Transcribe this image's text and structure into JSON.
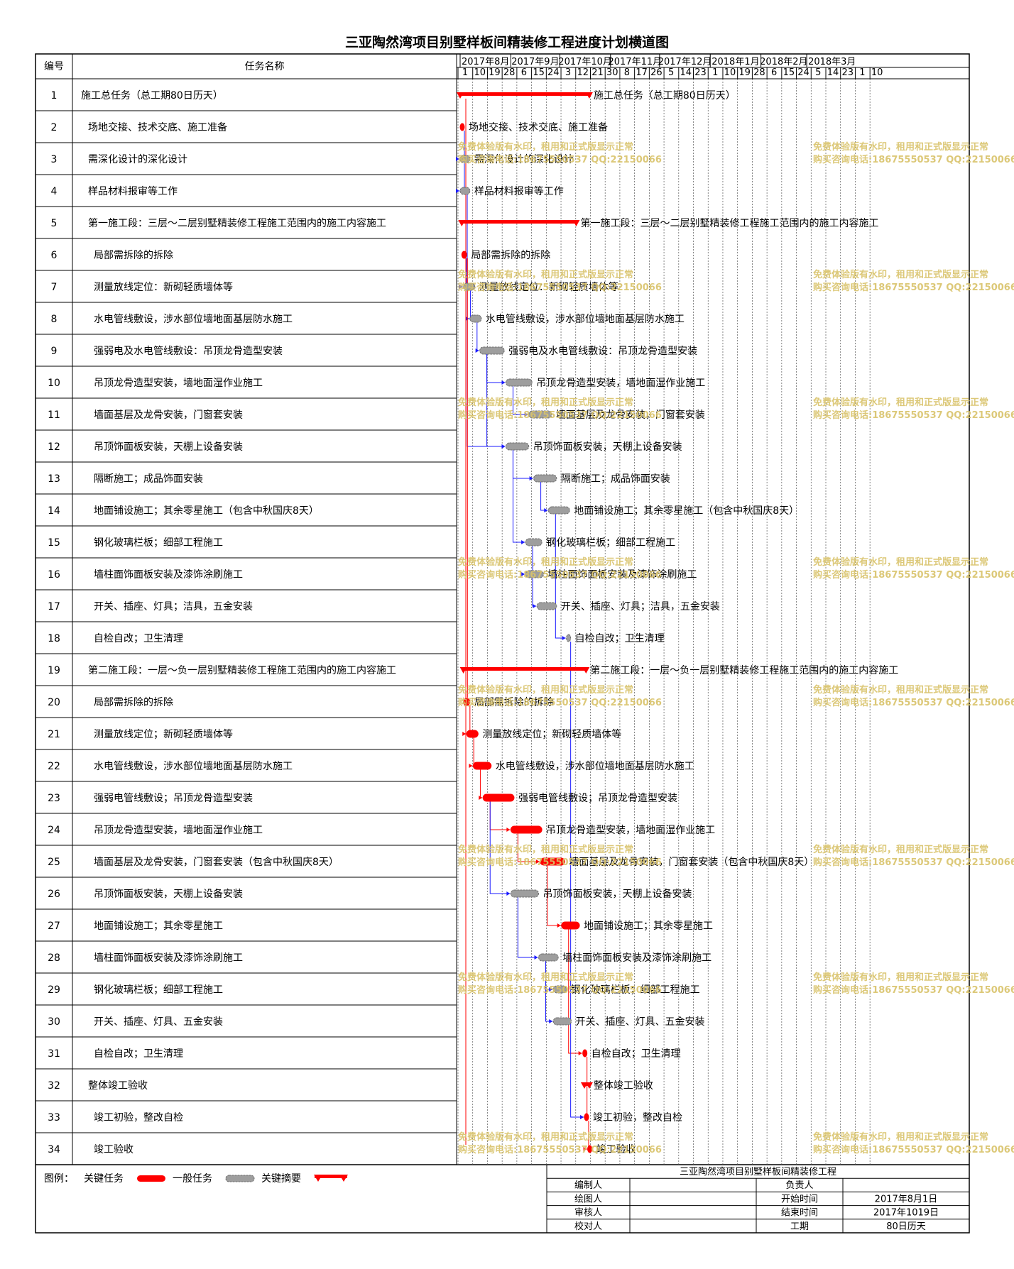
{
  "title": "三亚陶然湾项目别墅样板间精装修工程进度计划横道图",
  "columns": {
    "id": "编号",
    "name": "任务名称"
  },
  "timeline": {
    "months": [
      "2017年8月",
      "2017年9月",
      "2017年10月",
      "2017年11月",
      "2017年12月",
      "2018年1月",
      "2018年2月",
      "2018年3月"
    ],
    "ticks": [
      "1",
      "10",
      "19",
      "28",
      "6",
      "15",
      "24",
      "3",
      "12",
      "21",
      "30",
      "8",
      "17",
      "26",
      "5",
      "14",
      "23",
      "1",
      "10",
      "19",
      "28",
      "6",
      "15",
      "24",
      "5",
      "14",
      "23",
      "1",
      "10"
    ]
  },
  "chart_data": {
    "type": "gantt",
    "title": "三亚陶然湾项目别墅样板间精装修工程进度计划横道图",
    "tasks": [
      {
        "id": 1,
        "name": "施工总任务（总工期80日历天）",
        "kind": "summary",
        "start": "2017-08-01",
        "end": "2017-10-19"
      },
      {
        "id": 2,
        "name": "场地交接、技术交底、施工准备",
        "kind": "critical",
        "start": "2017-08-01",
        "end": "2017-08-02"
      },
      {
        "id": 3,
        "name": "需深化设计的深化设计",
        "kind": "general",
        "start": "2017-08-01",
        "end": "2017-08-07"
      },
      {
        "id": 4,
        "name": "样品材料报审等工作",
        "kind": "general",
        "start": "2017-08-01",
        "end": "2017-08-07"
      },
      {
        "id": 5,
        "name": "第一施工段：三层～二层别墅精装修工程施工范围内的施工内容施工",
        "kind": "summary",
        "start": "2017-08-02",
        "end": "2017-10-11"
      },
      {
        "id": 6,
        "name": "局部需拆除的拆除",
        "kind": "critical",
        "start": "2017-08-02",
        "end": "2017-08-05"
      },
      {
        "id": 7,
        "name": "测量放线定位：新砌轻质墙体等",
        "kind": "general",
        "start": "2017-08-03",
        "end": "2017-08-10"
      },
      {
        "id": 8,
        "name": "水电管线敷设，涉水部位墙地面基层防水施工",
        "kind": "general",
        "start": "2017-08-07",
        "end": "2017-08-14"
      },
      {
        "id": 9,
        "name": "强弱电及水电管线敷设：吊顶龙骨造型安装",
        "kind": "general",
        "start": "2017-08-13",
        "end": "2017-08-28"
      },
      {
        "id": 10,
        "name": "吊顶龙骨造型安装，墙地面湿作业施工",
        "kind": "general",
        "start": "2017-08-29",
        "end": "2017-09-14"
      },
      {
        "id": 11,
        "name": "墙面基层及龙骨安装，门窗套安装",
        "kind": "general",
        "start": "2017-09-12",
        "end": "2017-09-26"
      },
      {
        "id": 12,
        "name": "吊顶饰面板安装，天棚上设备安装",
        "kind": "general",
        "start": "2017-08-29",
        "end": "2017-09-12"
      },
      {
        "id": 13,
        "name": "隔断施工；成品饰面安装",
        "kind": "general",
        "start": "2017-09-15",
        "end": "2017-09-29"
      },
      {
        "id": 14,
        "name": "地面铺设施工；其余零星施工（包含中秋国庆8天）",
        "kind": "general",
        "start": "2017-09-24",
        "end": "2017-10-07"
      },
      {
        "id": 15,
        "name": "钢化玻璃栏板；细部工程施工",
        "kind": "general",
        "start": "2017-09-10",
        "end": "2017-09-20"
      },
      {
        "id": 16,
        "name": "墙柱面饰面板安装及漆饰涂刷施工",
        "kind": "general",
        "start": "2017-09-10",
        "end": "2017-09-21"
      },
      {
        "id": 17,
        "name": "开关、插座、灯具；洁具，五金安装",
        "kind": "general",
        "start": "2017-09-17",
        "end": "2017-09-29"
      },
      {
        "id": 18,
        "name": "自检自改；卫生清理",
        "kind": "general",
        "start": "2017-10-05",
        "end": "2017-10-07"
      },
      {
        "id": 19,
        "name": "第二施工段：一层～负一层别墅精装修工程施工范围内的施工内容施工",
        "kind": "summary",
        "start": "2017-08-03",
        "end": "2017-10-17"
      },
      {
        "id": 20,
        "name": "局部需拆除的拆除",
        "kind": "critical",
        "start": "2017-08-03",
        "end": "2017-08-07"
      },
      {
        "id": 21,
        "name": "测量放线定位；新砌轻质墙体等",
        "kind": "critical",
        "start": "2017-08-05",
        "end": "2017-08-12"
      },
      {
        "id": 22,
        "name": "水电管线敷设，涉水部位墙地面基层防水施工",
        "kind": "critical",
        "start": "2017-08-09",
        "end": "2017-08-20"
      },
      {
        "id": 23,
        "name": "强弱电管线敷设；吊顶龙骨造型安装",
        "kind": "critical",
        "start": "2017-08-15",
        "end": "2017-09-03"
      },
      {
        "id": 24,
        "name": "吊顶龙骨造型安装，墙地面湿作业施工",
        "kind": "critical",
        "start": "2017-09-01",
        "end": "2017-09-20"
      },
      {
        "id": 25,
        "name": "墙面基层及龙骨安装，门窗套安装（包含中秋国庆8天）",
        "kind": "critical",
        "start": "2017-09-19",
        "end": "2017-10-04"
      },
      {
        "id": 26,
        "name": "吊顶饰面板安装，天棚上设备安装",
        "kind": "general",
        "start": "2017-09-01",
        "end": "2017-09-18"
      },
      {
        "id": 27,
        "name": "地面铺设施工；其余零星施工",
        "kind": "critical",
        "start": "2017-10-02",
        "end": "2017-10-13"
      },
      {
        "id": 28,
        "name": "墙柱面饰面板安装及漆饰涂刷施工",
        "kind": "general",
        "start": "2017-09-18",
        "end": "2017-09-30"
      },
      {
        "id": 29,
        "name": "钢化玻璃栏板；细部工程施工",
        "kind": "general",
        "start": "2017-09-27",
        "end": "2017-10-05"
      },
      {
        "id": 30,
        "name": "开关、插座、灯具、五金安装",
        "kind": "general",
        "start": "2017-09-27",
        "end": "2017-10-08"
      },
      {
        "id": 31,
        "name": "自检自改；卫生清理",
        "kind": "critical",
        "start": "2017-10-15",
        "end": "2017-10-17"
      },
      {
        "id": 32,
        "name": "整体竣工验收",
        "kind": "summary",
        "start": "2017-10-16",
        "end": "2017-10-19"
      },
      {
        "id": 33,
        "name": "竣工初验，整改自检",
        "kind": "critical",
        "start": "2017-10-16",
        "end": "2017-10-18"
      },
      {
        "id": 34,
        "name": "竣工验收",
        "kind": "critical",
        "start": "2017-10-18",
        "end": "2017-10-19"
      }
    ]
  },
  "legend": {
    "label": "图例：",
    "critical": "关键任务",
    "general": "一般任务",
    "summary": "关键摘要"
  },
  "info": {
    "project": "三亚陶然湾项目别墅样板间精装修工程",
    "editor_label": "编制人",
    "drawer_label": "绘图人",
    "reviewer_label": "审核人",
    "checker_label": "校对人",
    "manager_label": "负责人",
    "start_label": "开始时间",
    "end_label": "结束时间",
    "duration_label": "工期",
    "start_value": "2017年8月1日",
    "end_value": "2017年1019日",
    "duration_value": "80日历天"
  },
  "watermark": {
    "line1": "免费体验版有水印，租用和正式版显示正常",
    "line2": "购买咨询电话:18675550537 QQ:22150066"
  },
  "colors": {
    "critical": "#ff0000",
    "general": "#9e9e9e",
    "summary": "#ff0000",
    "link": "#1a1aff",
    "grid": "#000000",
    "watermark": "#d9c36a"
  }
}
